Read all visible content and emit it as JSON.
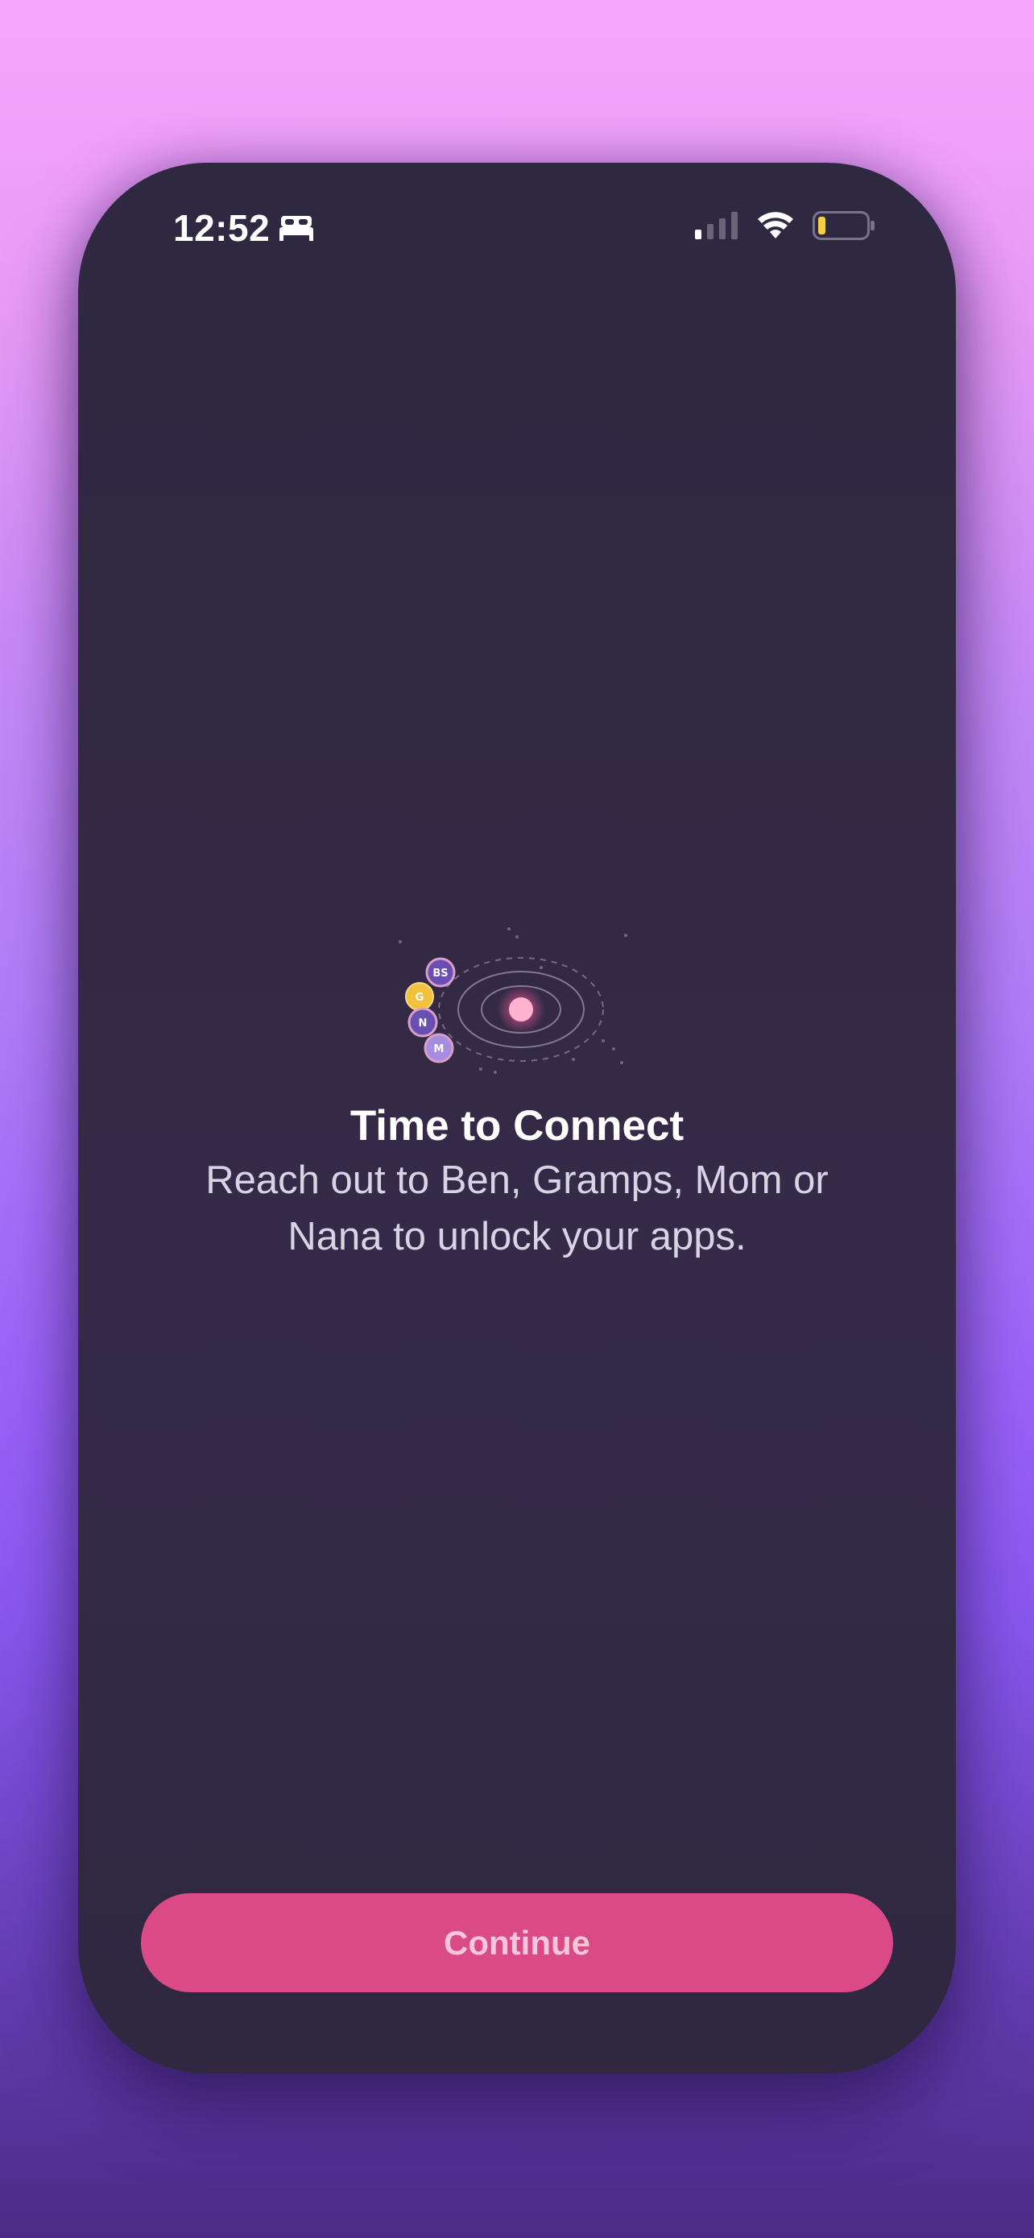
{
  "status_bar": {
    "time": "12:52",
    "sleep_icon": "bed-icon",
    "signal_icon": "cellular-signal-icon",
    "wifi_icon": "wifi-icon",
    "battery_icon": "battery-low-icon",
    "battery_color": "#f4d03f"
  },
  "illustration": {
    "avatars": [
      {
        "initials": "BS",
        "color": "#6a4fb3"
      },
      {
        "initials": "G",
        "color": "#f2c23c"
      },
      {
        "initials": "N",
        "color": "#6a4fb3"
      },
      {
        "initials": "M",
        "color": "#a58ee0"
      }
    ],
    "center_color": "#ffb3d1"
  },
  "content": {
    "title": "Time to Connect",
    "subtitle": "Reach out to Ben, Gramps, Mom or Nana to unlock your apps."
  },
  "actions": {
    "continue_label": "Continue",
    "accent_color": "#da4a86"
  }
}
